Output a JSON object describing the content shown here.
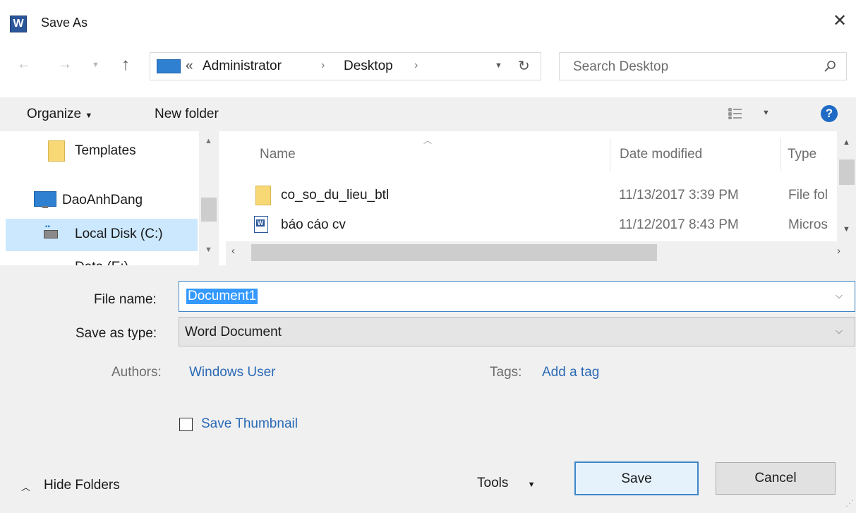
{
  "window": {
    "title": "Save As",
    "app_icon_letter": "W"
  },
  "address": {
    "overflow": "«",
    "crumbs": [
      "Administrator",
      "Desktop"
    ]
  },
  "search": {
    "placeholder": "Search Desktop"
  },
  "toolbar": {
    "organize": "Organize",
    "new_folder": "New folder"
  },
  "nav": {
    "items": [
      {
        "label": "Templates",
        "icon": "folder-icon"
      },
      {
        "label": "DaoAnhDang",
        "icon": "computer-icon"
      },
      {
        "label": "Local Disk (C:)",
        "icon": "drive-icon",
        "selected": true
      },
      {
        "label": "Data (E:)",
        "icon": "drive-icon"
      }
    ]
  },
  "files": {
    "columns": {
      "name": "Name",
      "date": "Date modified",
      "type": "Type"
    },
    "rows": [
      {
        "name": "co_so_du_lieu_btl",
        "date": "11/13/2017 3:39 PM",
        "type": "File fol",
        "icon": "folder-icon"
      },
      {
        "name": "báo cáo cv",
        "date": "11/12/2017 8:43 PM",
        "type": "Micros",
        "icon": "word-doc-icon"
      }
    ]
  },
  "form": {
    "file_name_label": "File name:",
    "file_name_value": "Document1",
    "save_type_label": "Save as type:",
    "save_type_value": "Word Document",
    "authors_label": "Authors:",
    "authors_value": "Windows User",
    "tags_label": "Tags:",
    "tags_value": "Add a tag",
    "thumbnail_label": "Save Thumbnail",
    "thumbnail_checked": false
  },
  "footer": {
    "hide_folders": "Hide Folders",
    "tools": "Tools",
    "save": "Save",
    "cancel": "Cancel"
  },
  "colors": {
    "accent": "#2a6ab5",
    "selection": "#3399ff",
    "help": "#1e6ac4",
    "folder": "#f8d775"
  }
}
